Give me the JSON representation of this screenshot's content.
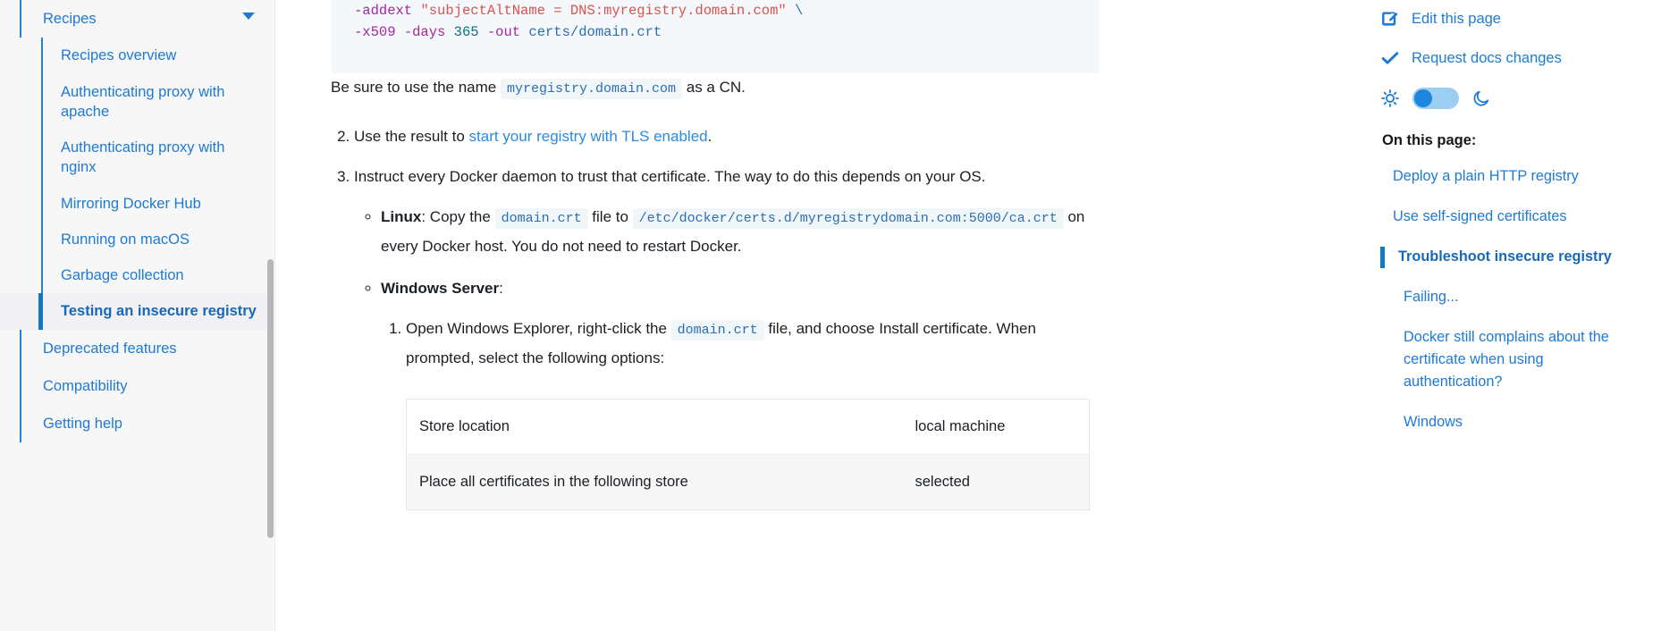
{
  "left_sidebar": {
    "group_label": "Recipes",
    "items": [
      {
        "label": "Recipes overview",
        "active": false
      },
      {
        "label": "Authenticating proxy with apache",
        "active": false
      },
      {
        "label": "Authenticating proxy with nginx",
        "active": false
      },
      {
        "label": "Mirroring Docker Hub",
        "active": false
      },
      {
        "label": "Running on macOS",
        "active": false
      },
      {
        "label": "Garbage collection",
        "active": false
      },
      {
        "label": "Testing an insecure registry",
        "active": true
      }
    ],
    "bottom_items": [
      {
        "label": "Deprecated features"
      },
      {
        "label": "Compatibility"
      },
      {
        "label": "Getting help"
      }
    ]
  },
  "code_block": {
    "line1": {
      "flag": "-addext",
      "string": "\"subjectAltName = DNS:myregistry.domain.com\"",
      "continuation": "\\"
    },
    "line2": {
      "flag_x509": "-x509",
      "flag_days": "-days",
      "days_value": "365",
      "flag_out": "-out",
      "out_value": "certs/domain.crt"
    }
  },
  "content": {
    "cn_note": {
      "before": "Be sure to use the name",
      "code": "myregistry.domain.com",
      "after": "as a CN."
    },
    "step2": {
      "before": "Use the result to ",
      "link": "start your registry with TLS enabled",
      "after": "."
    },
    "step3": "Instruct every Docker daemon to trust that certificate. The way to do this depends on your OS.",
    "linux": {
      "label": "Linux",
      "text1": ": Copy the ",
      "code1": "domain.crt",
      "text2": " file to ",
      "code2": "/etc/docker/certs.d/myregistrydomain.com:5000/ca.crt",
      "text3": " on every Docker host. You do not need to restart Docker."
    },
    "windows": {
      "label": "Windows Server",
      "colon": ":",
      "step1": {
        "text1": "Open Windows Explorer, right-click the ",
        "code1": "domain.crt",
        "text2": " file, and choose Install certificate. When prompted, select the following options:"
      }
    },
    "table": {
      "rows": [
        {
          "option": "Store location",
          "value": "local machine"
        },
        {
          "option": "Place all certificates in the following store",
          "value": "selected"
        }
      ]
    }
  },
  "right_sidebar": {
    "actions": [
      {
        "label": "Edit this page",
        "icon": "edit-pencil-icon"
      },
      {
        "label": "Request docs changes",
        "icon": "check-icon"
      }
    ],
    "theme": {
      "light_icon": "sun-icon",
      "dark_icon": "moon-icon",
      "state": "light"
    },
    "on_this_page_title": "On this page:",
    "toc": [
      {
        "label": "Deploy a plain HTTP registry",
        "active": false,
        "sub": false
      },
      {
        "label": "Use self-signed certificates",
        "active": false,
        "sub": false
      },
      {
        "label": "Troubleshoot insecure registry",
        "active": true,
        "sub": false
      },
      {
        "label": "Failing...",
        "active": false,
        "sub": true
      },
      {
        "label": "Docker still complains about the certificate when using authentication?",
        "active": false,
        "sub": true
      },
      {
        "label": "Windows",
        "active": false,
        "sub": true
      }
    ]
  },
  "colors": {
    "link_blue": "#1e7ad3",
    "active_blue": "#1279c6",
    "sidebar_bg": "#f7f7f8",
    "code_bg": "#f4f8fa",
    "inline_code_bg": "#f1f6f9"
  }
}
